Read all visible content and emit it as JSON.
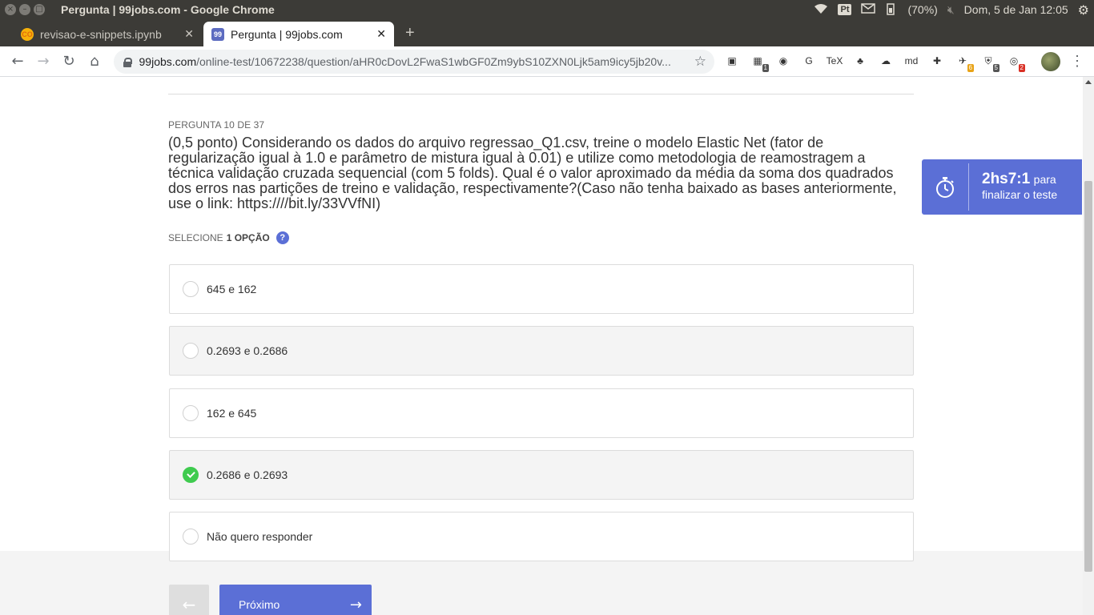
{
  "os": {
    "window_title": "Pergunta | 99jobs.com - Google Chrome",
    "tray_box": "Pt",
    "battery": "(70%)",
    "clock": "Dom,  5 de Jan 12:05"
  },
  "tabs": [
    {
      "label": "revisao-e-snippets.ipynb",
      "favicon": "CO"
    },
    {
      "label": "Pergunta | 99jobs.com",
      "favicon": "99"
    }
  ],
  "address": {
    "host": "99jobs.com",
    "path": "/online-test/10672238/question/aHR0cDovL2FwaS1wbGF0Zm9ybS10ZXN0Ljk5am9icy5jb20v..."
  },
  "extensions": [
    {
      "name": "square-ext-icon",
      "glyph": "▣",
      "badge": ""
    },
    {
      "name": "calendar-ext-icon",
      "glyph": "▦",
      "badge": "1",
      "badge_color": "#555555"
    },
    {
      "name": "camera-ext-icon",
      "glyph": "◉",
      "badge": ""
    },
    {
      "name": "translate-ext-icon",
      "glyph": "G",
      "badge": ""
    },
    {
      "name": "tex-ext-icon",
      "glyph": "TeX",
      "badge": ""
    },
    {
      "name": "gnome-ext-icon",
      "glyph": "♣",
      "badge": ""
    },
    {
      "name": "cloud-ext-icon",
      "glyph": "☁",
      "badge": ""
    },
    {
      "name": "markdown-ext-icon",
      "glyph": "md",
      "badge": ""
    },
    {
      "name": "google-ext-icon",
      "glyph": "✚",
      "badge": ""
    },
    {
      "name": "plane-ext-icon",
      "glyph": "✈",
      "badge": "6",
      "badge_color": "#e8a317"
    },
    {
      "name": "shield-ext-icon",
      "glyph": "⛨",
      "badge": "5",
      "badge_color": "#555555"
    },
    {
      "name": "alert-ext-icon",
      "glyph": "◎",
      "badge": "2",
      "badge_color": "#d93025"
    }
  ],
  "question": {
    "meta": "PERGUNTA 10 DE 37",
    "text": "(0,5 ponto) Considerando os dados do arquivo regressao_Q1.csv, treine o modelo Elastic Net (fator de regularização igual à 1.0 e parâmetro de mistura igual à 0.01) e utilize como metodologia de reamostragem a técnica validação cruzada sequencial (com 5 folds). Qual é o valor aproximado da média da soma dos quadrados dos erros nas partições de treino e validação, respectivamente?(Caso não tenha baixado as bases anteriormente, use o link: https:////bit.ly/33VVfNI)",
    "select_prefix": "SELECIONE",
    "select_count": "1 OPÇÃO",
    "help": "?"
  },
  "options": [
    {
      "label": "645 e 162",
      "selected": false
    },
    {
      "label": "0.2693 e 0.2686",
      "selected": false
    },
    {
      "label": "162 e 645",
      "selected": false
    },
    {
      "label": "0.2686 e 0.2693",
      "selected": true
    },
    {
      "label": "Não quero responder",
      "selected": false
    }
  ],
  "buttons": {
    "prev": "←",
    "next": "Próximo",
    "next_arrow": "→"
  },
  "timer": {
    "value": "2hs7:1",
    "suffix_1": "para",
    "suffix_2": "finalizar o teste"
  },
  "colors": {
    "accent": "#5b6fd6",
    "selected": "#3fcb4f"
  }
}
